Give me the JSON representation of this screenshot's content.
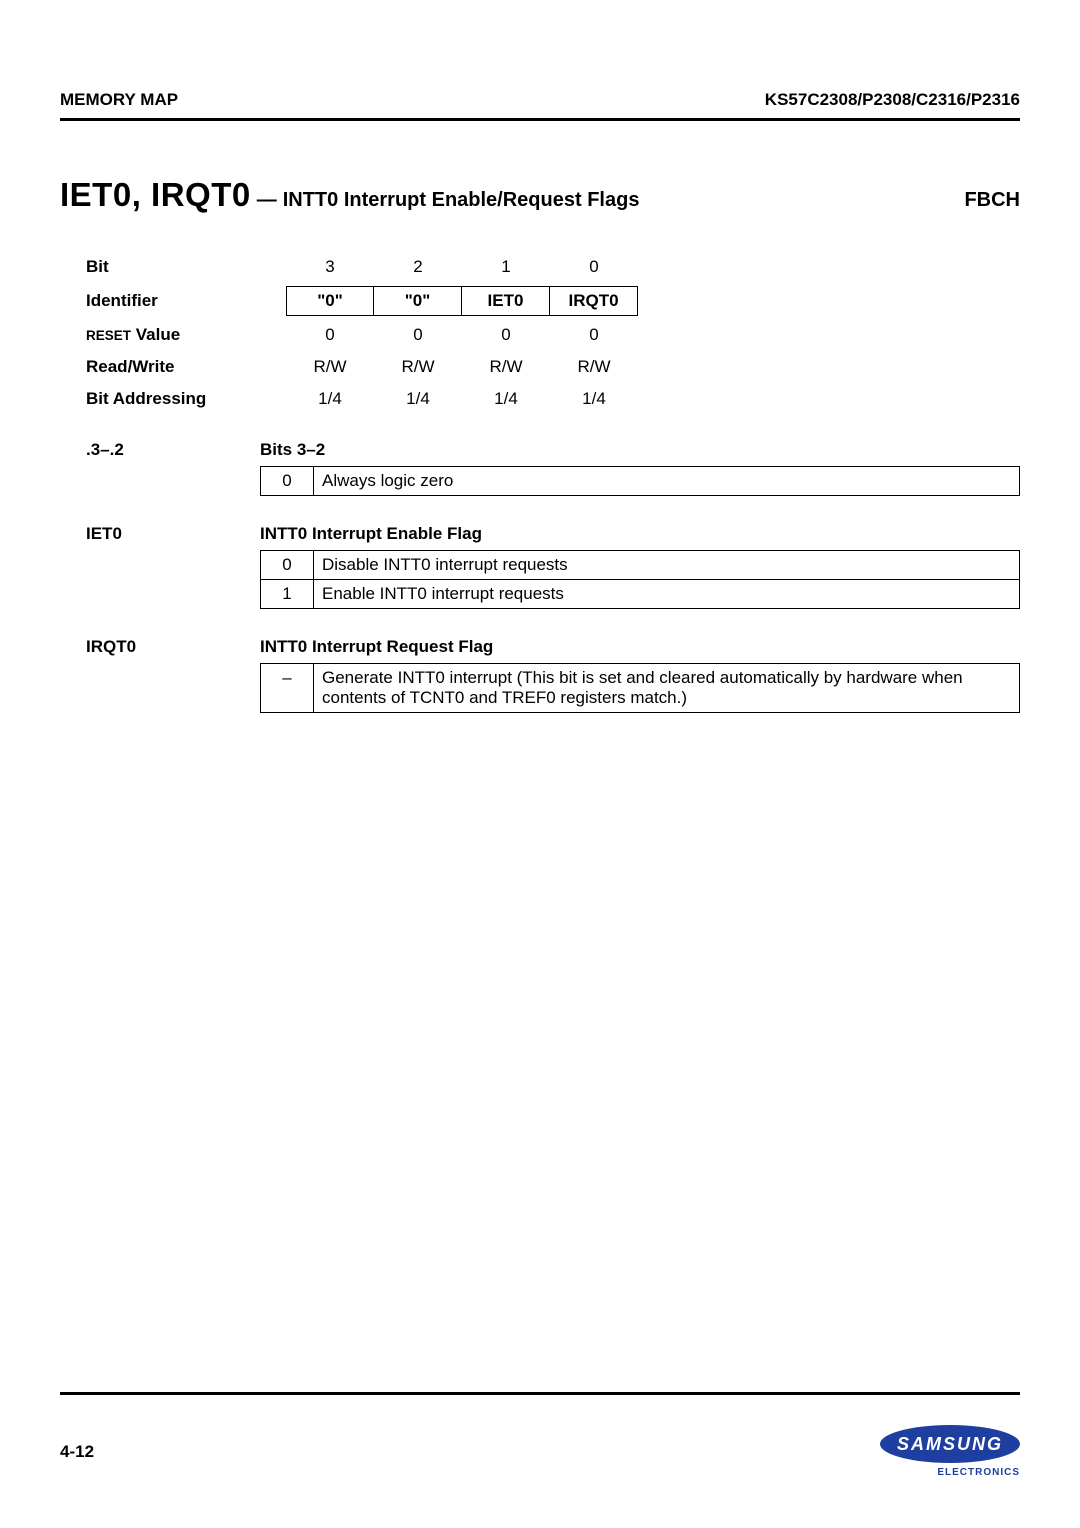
{
  "header": {
    "left": "MEMORY MAP",
    "right": "KS57C2308/P2308/C2316/P2316"
  },
  "title": {
    "reg_name": "IET0, IRQT0",
    "dash": "—",
    "desc": "INTT0 Interrupt Enable/Request Flags",
    "addr": "FBCH"
  },
  "spec": {
    "bit_label": "Bit",
    "bit": [
      "3",
      "2",
      "1",
      "0"
    ],
    "identifier_label": "Identifier",
    "identifier": [
      "\"0\"",
      "\"0\"",
      "IET0",
      "IRQT0"
    ],
    "reset_label_pre": "RESET",
    "reset_label_post": " Value",
    "reset": [
      "0",
      "0",
      "0",
      "0"
    ],
    "rw_label": "Read/Write",
    "rw": [
      "R/W",
      "R/W",
      "R/W",
      "R/W"
    ],
    "addr_label": "Bit Addressing",
    "addr": [
      "1/4",
      "1/4",
      "1/4",
      "1/4"
    ]
  },
  "sections": {
    "bits32": {
      "label": ".3–.2",
      "title": "Bits 3–2",
      "rows": [
        {
          "val": "0",
          "desc": "Always logic zero"
        }
      ]
    },
    "iet0": {
      "label": "IET0",
      "title": "INTT0 Interrupt Enable Flag",
      "rows": [
        {
          "val": "0",
          "desc": "Disable INTT0 interrupt requests"
        },
        {
          "val": "1",
          "desc": "Enable INTT0 interrupt requests"
        }
      ]
    },
    "irqt0": {
      "label": "IRQT0",
      "title": "INTT0 Interrupt Request Flag",
      "rows": [
        {
          "val": "–",
          "desc": "Generate INTT0 interrupt (This bit is set and cleared automatically by hardware when contents of TCNT0 and TREF0 registers match.)"
        }
      ]
    }
  },
  "footer": {
    "page": "4-12",
    "logo_text": "SAMSUNG",
    "electronics": "ELECTRONICS"
  }
}
